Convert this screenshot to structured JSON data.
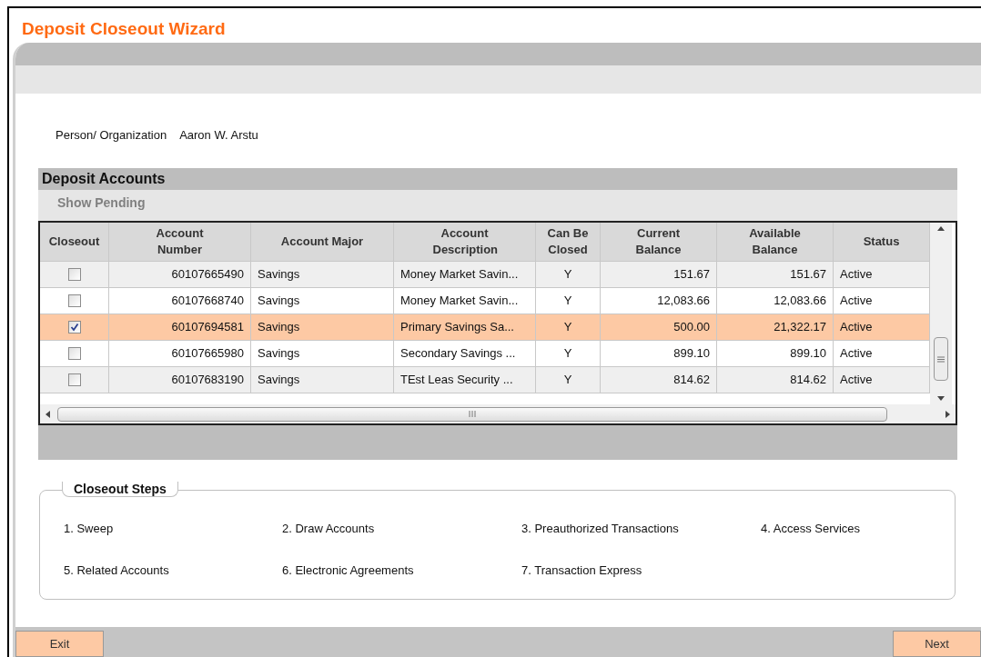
{
  "window": {
    "title": "Deposit Closeout Wizard"
  },
  "person": {
    "label": "Person/ Organization",
    "value": "Aaron W. Arstu"
  },
  "deposit_accounts": {
    "title": "Deposit Accounts",
    "toolbar": [
      "Show Pending"
    ],
    "table": {
      "checkbox_column": "Closeout",
      "columns": [
        "Account Number",
        "Account Major",
        "Account Description",
        "Can Be Closed",
        "Current Balance",
        "Available Balance",
        "Status"
      ],
      "rows": [
        {
          "checked": false,
          "selected": false,
          "cells": [
            "60107665490",
            "Savings",
            "Money Market Savin...",
            "Y",
            "151.67",
            "151.67",
            "Active"
          ]
        },
        {
          "checked": false,
          "selected": false,
          "cells": [
            "60107668740",
            "Savings",
            "Money Market Savin...",
            "Y",
            "12,083.66",
            "12,083.66",
            "Active"
          ]
        },
        {
          "checked": true,
          "selected": true,
          "cells": [
            "60107694581",
            "Savings",
            "Primary Savings Sa...",
            "Y",
            "500.00",
            "21,322.17",
            "Active"
          ]
        },
        {
          "checked": false,
          "selected": false,
          "cells": [
            "60107665980",
            "Savings",
            "Secondary Savings ...",
            "Y",
            "899.10",
            "899.10",
            "Active"
          ]
        },
        {
          "checked": false,
          "selected": false,
          "cells": [
            "60107683190",
            "Savings",
            "TEst Leas Security ...",
            "Y",
            "814.62",
            "814.62",
            "Active"
          ]
        }
      ]
    }
  },
  "closeout_steps": {
    "title": "Closeout Steps",
    "steps": [
      "1. Sweep",
      "2. Draw Accounts",
      "3. Preauthorized Transactions",
      "4. Access Services",
      "5. Related Accounts",
      "6. Electronic Agreements",
      "7. Transaction Express"
    ]
  },
  "buttons": [
    "Exit",
    "Next"
  ]
}
